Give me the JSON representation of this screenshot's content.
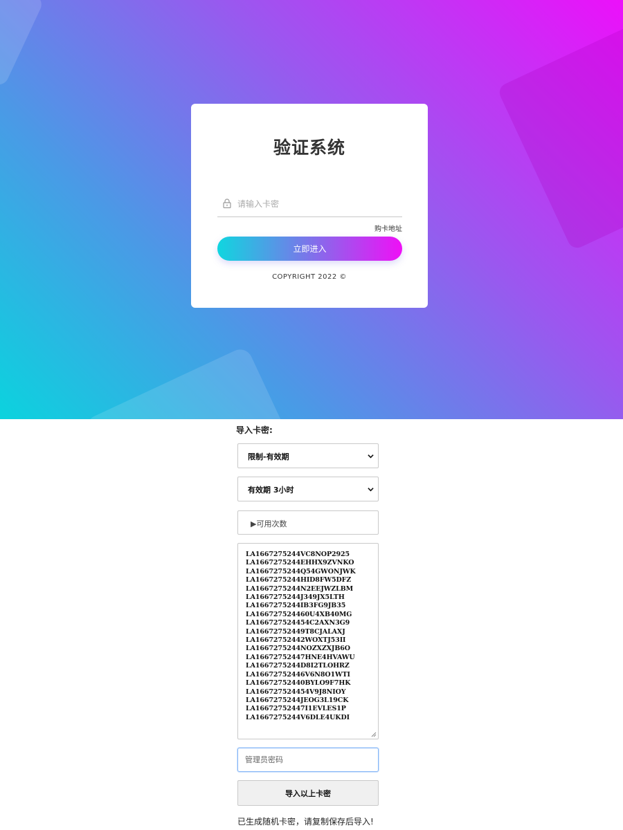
{
  "login": {
    "title": "验证系统",
    "password_placeholder": "请输入卡密",
    "buy_link": "购卡地址",
    "enter_button": "立即进入",
    "copyright": "COPYRIGHT 2022 ©"
  },
  "import_form": {
    "heading": "导入卡密:",
    "type_select": "限制-有效期",
    "duration_select": "有效期 3小时",
    "uses_details": "▶可用次数",
    "codes": [
      "LA1667275244VC8NOP2925",
      "LA1667275244EHHX9ZVNKO",
      "LA1667275244Q54GWONJWK",
      "LA1667275244HID8FW5DFZ",
      "LA1667275244N2EEJWZLBM",
      "LA1667275244J349JX5LTH",
      "LA1667275244IB3FG9JB35",
      "LA166727524460U4XB40MG",
      "LA166727524454C2AXN3G9",
      "LA16672752449T8CJALAXJ",
      "LA16672752442WOXTJ53II",
      "LA1667275244NOZXZXJB6O",
      "LA16672752447HNE4HVAWU",
      "LA1667275244D8I2TLOHRZ",
      "LA16672752446V6N8O1WTI",
      "LA16672752440BYLO9F7HK",
      "LA166727524454V9J8NIOY",
      "LA1667275244JEOG3L19CK",
      "LA16672752447I1EVLES1P",
      "LA1667275244V6DLE4UKDI"
    ],
    "admin_password_placeholder": "管理员密码",
    "import_button": "导入以上卡密",
    "notice": "已生成随机卡密，请复制保存后导入!"
  }
}
